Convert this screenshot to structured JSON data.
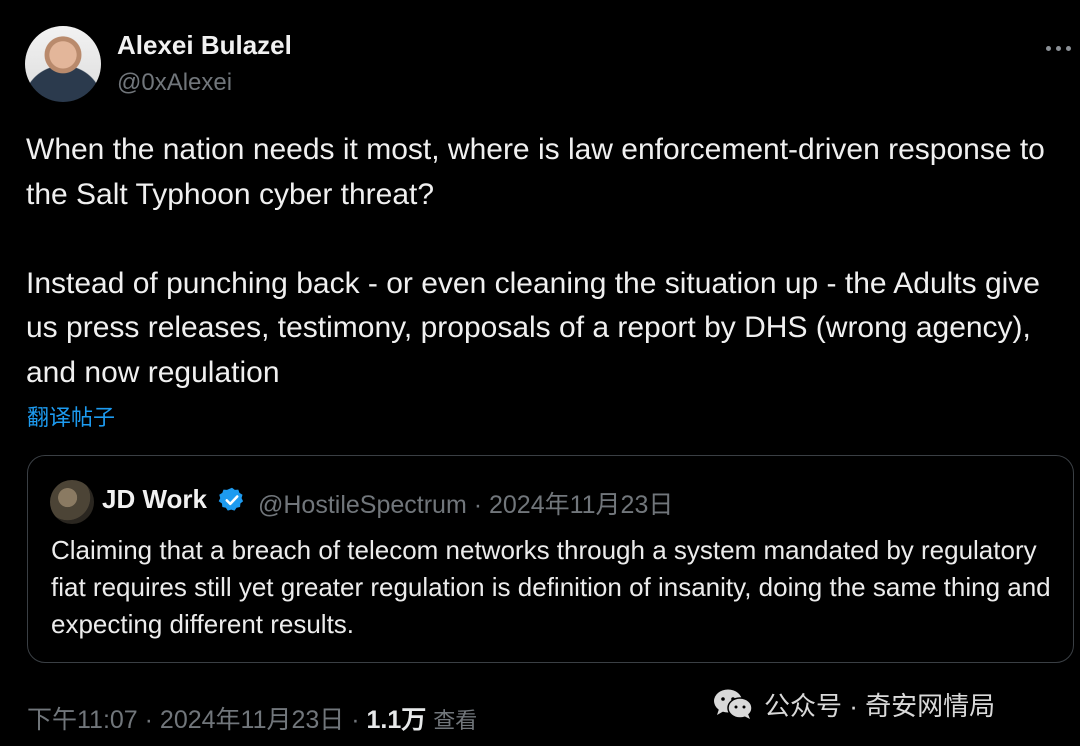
{
  "author": {
    "name": "Alexei Bulazel",
    "handle": "@0xAlexei"
  },
  "post": {
    "paragraphs": [
      "When the nation needs it most, where is law enforcement-driven response to the Salt Typhoon cyber threat?",
      "Instead of punching back - or even cleaning the situation up - the Adults give us press releases, testimony, proposals of a report by DHS (wrong agency), and now regulation"
    ],
    "translate_label": "翻译帖子"
  },
  "quote": {
    "name": "JD Work",
    "handle_date": "@HostileSpectrum · 2024年11月23日",
    "text": "Claiming that a breach of telecom networks through a system mandated by regulatory fiat requires still yet greater regulation is definition of insanity, doing the same thing and expecting different results."
  },
  "footer": {
    "time_date": "下午11:07 · 2024年11月23日 · ",
    "views_count": "1.1万",
    "views_label": "查看"
  },
  "watermark": {
    "text": "公众号 · 奇安网情局"
  },
  "icons": {
    "more": "more-horizontal-icon",
    "verified": "verified-badge-icon",
    "wechat": "wechat-logo-icon"
  },
  "colors": {
    "background": "#000000",
    "link": "#1d9bf0",
    "verified": "#1d9bf0",
    "muted": "#71767b"
  }
}
